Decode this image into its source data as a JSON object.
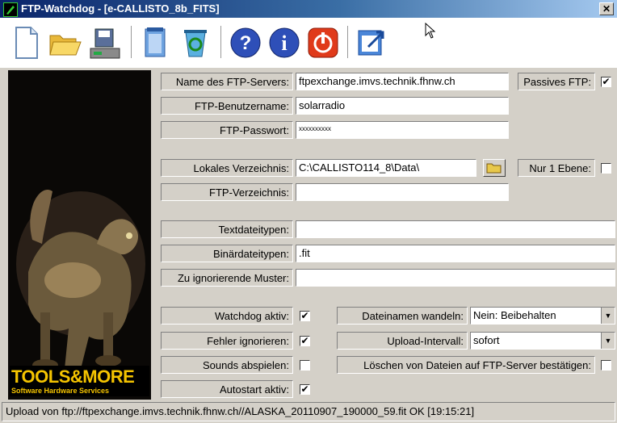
{
  "window": {
    "title": "FTP-Watchdog - [e-CALLISTO_8b_FITS]",
    "close": "✕"
  },
  "toolbar": {
    "buttons": [
      "new-file-icon",
      "open-folder-icon",
      "save-disk-icon",
      "notepad-icon",
      "recycle-icon",
      "help-icon",
      "info-icon",
      "power-icon",
      "export-icon"
    ]
  },
  "logo": {
    "line1": "TOOLS&MORE",
    "line2": "Software Hardware Services"
  },
  "fields": {
    "server_label": "Name des FTP-Servers:",
    "server_value": "ftpexchange.imvs.technik.fhnw.ch",
    "passive_label": "Passives FTP:",
    "passive_checked": "✔",
    "user_label": "FTP-Benutzername:",
    "user_value": "solarradio",
    "password_label": "FTP-Passwort:",
    "password_value": "xxxxxxxxxx",
    "localdir_label": "Lokales Verzeichnis:",
    "localdir_value": "C:\\CALLISTO114_8\\Data\\",
    "onelevel_label": "Nur 1 Ebene:",
    "ftpdir_label": "FTP-Verzeichnis:",
    "ftpdir_value": "",
    "texttypes_label": "Textdateitypen:",
    "texttypes_value": "",
    "bintypes_label": "Binärdateitypen:",
    "bintypes_value": ".fit",
    "ignore_label": "Zu ignorierende Muster:",
    "ignore_value": ""
  },
  "options": {
    "watchdog_label": "Watchdog aktiv:",
    "watchdog_checked": "✔",
    "ignoreerr_label": "Fehler ignorieren:",
    "ignoreerr_checked": "✔",
    "sounds_label": "Sounds abspielen:",
    "autostart_label": "Autostart aktiv:",
    "autostart_checked": "✔",
    "rename_label": "Dateinamen wandeln:",
    "rename_value": "Nein: Beibehalten",
    "interval_label": "Upload-Intervall:",
    "interval_value": "sofort",
    "confirmdel_label": "Löschen von Dateien auf FTP-Server bestätigen:",
    "dropdown_arrow": "▼"
  },
  "status": {
    "text": "Upload von ftp://ftpexchange.imvs.technik.fhnw.ch//ALASKA_20110907_190000_59.fit OK [19:15:21]"
  }
}
